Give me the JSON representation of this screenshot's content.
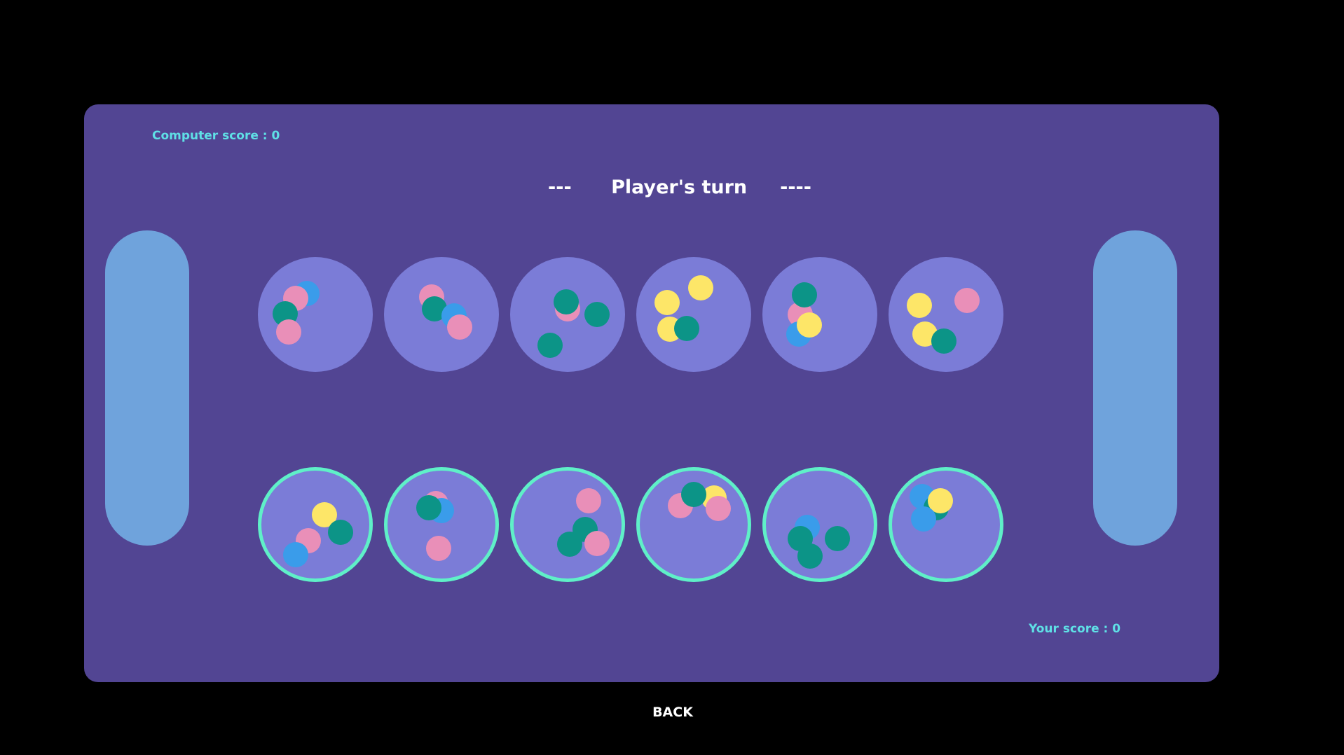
{
  "scores": {
    "computer": "Computer score : 0",
    "player": "Your score : 0"
  },
  "turn_text": "---      Player's turn     ----",
  "back_label": "BACK",
  "colors": {
    "background": "#000000",
    "board": "#524593",
    "pit": "#7b7cd7",
    "store": "#6fa3dc",
    "selectable_ring": "#5ff0c8",
    "score_text": "#5fe0e6",
    "seed_pink": "#e98fb8",
    "seed_teal": "#0c9487",
    "seed_yellow": "#fde668",
    "seed_blue": "#3a9cea"
  },
  "pits": {
    "computer": [
      {
        "seeds": [
          "blue",
          "pink",
          "teal",
          "pink"
        ]
      },
      {
        "seeds": [
          "pink",
          "teal",
          "blue",
          "pink"
        ]
      },
      {
        "seeds": [
          "pink",
          "teal",
          "teal",
          "teal"
        ]
      },
      {
        "seeds": [
          "yellow",
          "yellow",
          "yellow",
          "teal"
        ]
      },
      {
        "seeds": [
          "pink",
          "teal",
          "blue",
          "yellow"
        ]
      },
      {
        "seeds": [
          "yellow",
          "pink",
          "yellow",
          "teal"
        ]
      }
    ],
    "player": [
      {
        "seeds": [
          "yellow",
          "teal",
          "pink",
          "blue"
        ]
      },
      {
        "seeds": [
          "pink",
          "blue",
          "teal",
          "pink"
        ]
      },
      {
        "seeds": [
          "pink",
          "teal",
          "teal",
          "pink"
        ]
      },
      {
        "seeds": [
          "yellow",
          "pink",
          "teal",
          "pink"
        ]
      },
      {
        "seeds": [
          "blue",
          "teal",
          "teal",
          "teal"
        ]
      },
      {
        "seeds": [
          "blue",
          "teal",
          "yellow",
          "blue"
        ]
      }
    ]
  }
}
